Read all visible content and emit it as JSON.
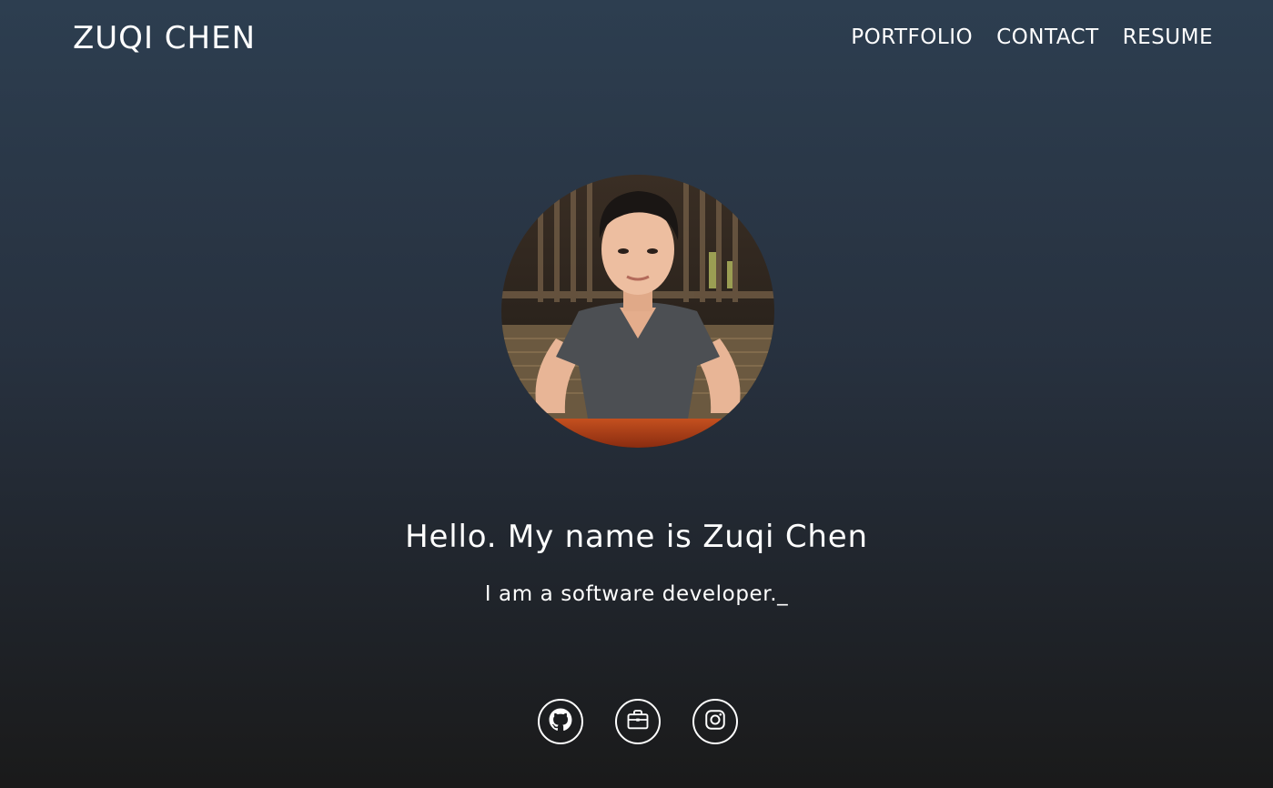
{
  "header": {
    "brand": "ZUQI CHEN",
    "nav": [
      "PORTFOLIO",
      "CONTACT",
      "RESUME"
    ]
  },
  "hero": {
    "headline": "Hello. My name is Zuqi Chen",
    "subline": "I am a software developer.",
    "cursor": "_"
  },
  "socials": [
    {
      "icon": "github-icon"
    },
    {
      "icon": "briefcase-icon"
    },
    {
      "icon": "instagram-icon"
    }
  ],
  "colors": {
    "text": "#ffffff",
    "background_top": "#2d3e50",
    "background_bottom": "#1a1a1a"
  }
}
